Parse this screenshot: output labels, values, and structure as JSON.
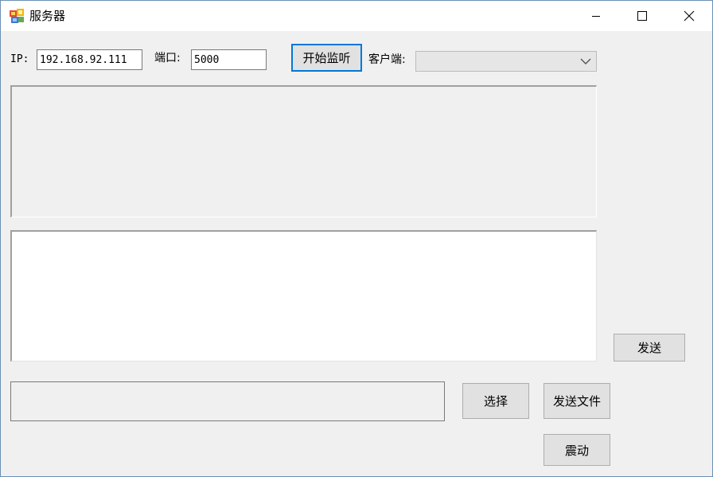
{
  "window": {
    "title": "服务器"
  },
  "connection": {
    "ip_label": "IP:",
    "ip_value": "192.168.92.111",
    "port_label": "端口:",
    "port_value": "5000",
    "start_button": "开始监听",
    "client_label": "客户端:",
    "client_selected": ""
  },
  "message": {
    "log_text": "",
    "input_text": "",
    "send_button": "发送"
  },
  "file": {
    "path_value": "",
    "select_button": "选择",
    "send_file_button": "发送文件"
  },
  "shake_button": "震动",
  "colors": {
    "accent": "#0078d7",
    "window_bg": "#f0f0f0",
    "button_bg": "#e1e1e1"
  }
}
